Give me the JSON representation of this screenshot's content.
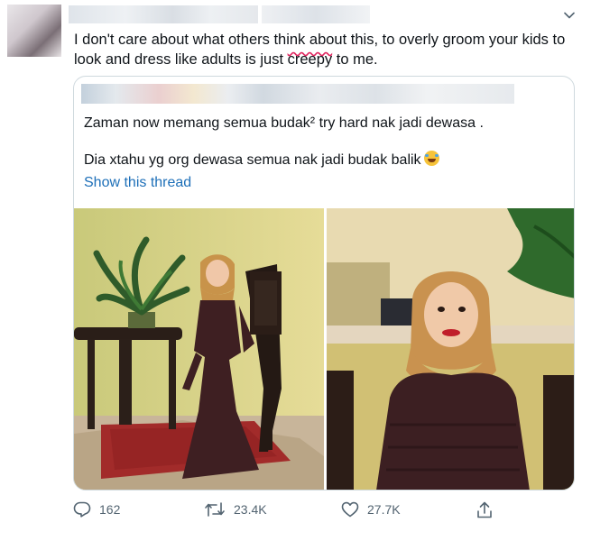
{
  "tweet": {
    "text_before": "I don't care about what others think about this, to overly groom your kids to look and dress like adults is just ",
    "text_marked": "creepy",
    "text_after": " to me."
  },
  "quoted": {
    "line1": "Zaman now memang semua budak² try hard nak jadi dewasa .",
    "line2": "Dia xtahu yg org dewasa semua nak jadi budak balik",
    "emoji_icon": "rolling-on-floor-laughing-emoji",
    "show_thread": "Show this thread"
  },
  "actions": {
    "reply_count": "162",
    "retweet_count": "23.4K",
    "like_count": "27.7K"
  },
  "colors": {
    "link": "#1d6fb8",
    "muted": "#536471",
    "border": "#cfd9de"
  }
}
